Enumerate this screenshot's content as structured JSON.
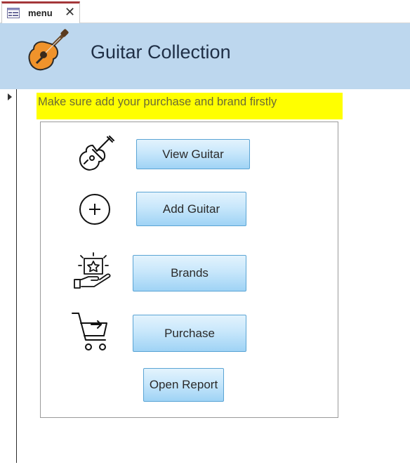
{
  "tab": {
    "label": "menu",
    "close_glyph": "✕",
    "icon": "form-icon"
  },
  "header": {
    "title": "Guitar Collection",
    "logo_icon": "guitar-logo-icon",
    "background": "#bdd7ee"
  },
  "note": {
    "text": "Make sure add your purchase and brand firstly",
    "background": "#ffff00"
  },
  "menu": {
    "items": [
      {
        "label": "View Guitar",
        "icon": "guitar-icon"
      },
      {
        "label": "Add Guitar",
        "icon": "plus-circle-icon"
      },
      {
        "label": "Brands",
        "icon": "brand-star-icon"
      },
      {
        "label": "Purchase",
        "icon": "cart-icon"
      }
    ],
    "report_button": "Open Report"
  },
  "colors": {
    "button_border": "#5aa4d4",
    "tab_accent": "#a4373a"
  }
}
